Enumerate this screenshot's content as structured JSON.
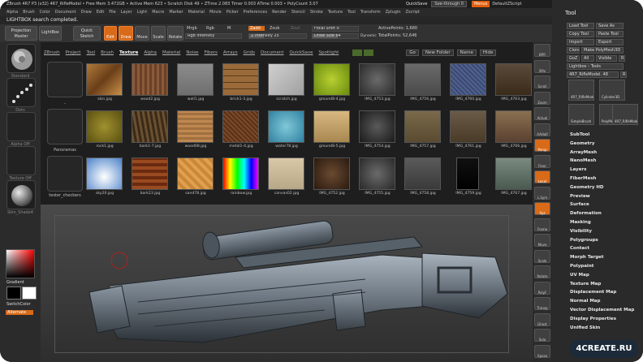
{
  "titlebar": {
    "title": "ZBrush 4R7 P3 (x32)    4R7_RifleModel  • Free Mem 3.472GB • Active Mem 623 • Scratch Disk 49 • ZTime 2.083 Timer 0.003 ATime 0.003 • PolyCount 3.07",
    "quicksave": "QuickSave",
    "seethrough": "See-through  0",
    "menus": "Menus",
    "default_script": "DefaultZScript",
    "window_controls": "– □ ×"
  },
  "menubar": [
    "Alpha",
    "Brush",
    "Color",
    "Document",
    "Draw",
    "Edit",
    "File",
    "Layer",
    "Light",
    "Macro",
    "Marker",
    "Material",
    "Movie",
    "Picker",
    "Preferences",
    "Render",
    "Stencil",
    "Stroke",
    "Texture",
    "Tool",
    "Transform",
    "Zplugin",
    "Zscript"
  ],
  "status": "LIGHTBOX search completed.",
  "shelf": {
    "projection_master": "Projection Master",
    "lightbox": "LightBox",
    "quick_sketch": "Quick Sketch",
    "edit": "Edit",
    "draw": "Draw",
    "move": "Move",
    "scale": "Scale",
    "rotate": "Rotate",
    "mrgb": "Mrgb",
    "rgb": "Rgb",
    "m": "M",
    "rgb_intensity": "Rgb Intensity",
    "zadd": "Zadd",
    "zsub": "Zsub",
    "zcut": "Zcut",
    "z_intensity": "Z Intensity 25",
    "focal_shift": "Focal Shift 0",
    "draw_size": "Draw Size 64",
    "dynamic": "Dynamic",
    "active_points": "ActivePoints: 1,680",
    "total_points": "TotalPoints: 52,646"
  },
  "left": {
    "brush_label": "Standard",
    "stroke_label": "Dots",
    "alpha_label": "Alpha Off",
    "texture_label": "Texture Off",
    "material_label": "Skin_Shade4",
    "gradient": "Gradient",
    "switch_color": "SwitchColor",
    "alternate": "Alternate"
  },
  "lightbox": {
    "tabs": [
      "ZBrush",
      "Project",
      "Tool",
      "Brush",
      "Texture",
      "Alpha",
      "Material",
      "Noise",
      "Fibers",
      "Arrays",
      "Grids",
      "Document",
      "QuickSave",
      "Spotlight"
    ],
    "active_tab": "Texture",
    "nav": [
      "Go",
      "New Folder",
      "Name",
      "Hide"
    ],
    "folders": [
      {
        "label": ".."
      },
      {
        "label": "Panoramas"
      },
      {
        "label": "tester_checkers"
      }
    ],
    "textures": [
      [
        "skin.jpg",
        "wood2.jpg",
        "wall1.jpg",
        "brick1-3.jpg",
        "scratch.jpg",
        "ground8-4.jpg",
        "IMG_4753.jpg",
        "IMG_4756.jpg",
        "IMG_4760.jpg",
        "IMG_4763.jpg"
      ],
      [
        "rock1.jpg",
        "bark1-7.jpg",
        "wood08.jpg",
        "metal1-4.jpg",
        "water78.jpg",
        "ground8-5.jpg",
        "IMG_4754.jpg",
        "IMG_4757.jpg",
        "IMG_4761.jpg",
        "IMG_4766.jpg"
      ],
      [
        "sky20.jpg",
        "bark23.jpg",
        "sand78.jpg",
        "rainbow.jpg",
        "canvas02.jpg",
        "IMG_4752.jpg",
        "IMG_4755.jpg",
        "IMG_4758.jpg",
        "IMG_4759.jpg",
        "IMG_4767.jpg"
      ]
    ]
  },
  "rightshelf": [
    "BPR",
    "SPix",
    "Scroll",
    "Zoom",
    "Actual",
    "AAHalf",
    "Persp",
    "Floor",
    "Local",
    "L.Sym",
    "Xyz",
    "Frame",
    "Move",
    "Scale",
    "Rotate",
    "PolyF",
    "Transp",
    "Ghost",
    "Solo",
    "Xpose"
  ],
  "toolpanel": {
    "title": "Tool",
    "buttons": [
      "Load Tool",
      "Save As",
      "Copy Tool",
      "Paste Tool",
      "Import",
      "Export",
      "Clone",
      "Make PolyMesh3D",
      "GoZ",
      "All",
      "Visible",
      "R",
      "Lightbox › Tools",
      "4R7_RifleModel. 48",
      "R"
    ],
    "thumbs": [
      "4R7_RifleModel",
      "Cylinder3D",
      "SimpleBrush",
      "PolyMesh3D",
      "4R7_RifleModel"
    ],
    "items": [
      "SubTool",
      "Geometry",
      "ArrayMesh",
      "NanoMesh",
      "Layers",
      "FiberMesh",
      "Geometry HD",
      "Preview",
      "Surface",
      "Deformation",
      "Masking",
      "Visibility",
      "Polygroups",
      "Contact",
      "Morph Target",
      "Polypaint",
      "UV Map",
      "Texture Map",
      "Displacement Map",
      "Normal Map",
      "Vector Displacement Map",
      "Display Properties",
      "Unified Skin"
    ]
  },
  "watermark": "4CREATE.RU",
  "colors": {
    "accent": "#d86a18",
    "panel": "#2a2a2a",
    "viewport": "#3a3a3a"
  }
}
